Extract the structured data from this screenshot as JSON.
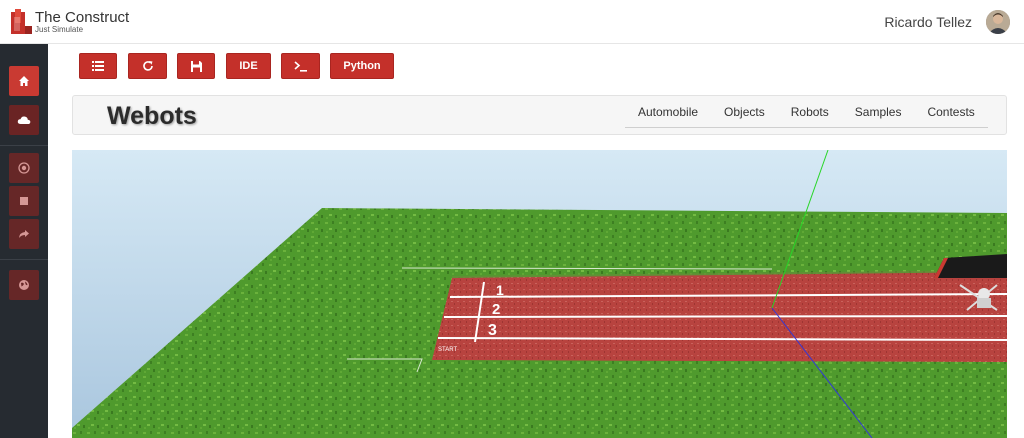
{
  "brand": {
    "name": "The Construct",
    "tagline": "Just Simulate"
  },
  "user": {
    "name": "Ricardo Tellez"
  },
  "toolbar": {
    "buttons": [
      {
        "label": "",
        "icon": "list-icon"
      },
      {
        "label": "",
        "icon": "refresh-icon"
      },
      {
        "label": "",
        "icon": "save-icon"
      },
      {
        "label": "IDE"
      },
      {
        "label": "",
        "icon": "terminal-icon"
      },
      {
        "label": "Python"
      }
    ]
  },
  "sidebar": {
    "items": [
      {
        "icon": "home-icon",
        "state": "active"
      },
      {
        "icon": "cloud-icon",
        "state": "selected"
      },
      {
        "icon": "record-icon",
        "state": "disabled"
      },
      {
        "icon": "stop-icon",
        "state": "disabled"
      },
      {
        "icon": "share-icon",
        "state": "disabled"
      },
      {
        "icon": "globe-icon",
        "state": "disabled"
      }
    ]
  },
  "webots": {
    "title": "Webots",
    "menu": [
      "Automobile",
      "Objects",
      "Robots",
      "Samples",
      "Contests"
    ]
  },
  "scene": {
    "lane_numbers": [
      "1",
      "2",
      "3"
    ],
    "start_label": "START"
  },
  "colors": {
    "accent": "#c4302a",
    "sidebar": "#262b31",
    "grass": "#4e9a2c",
    "track": "#b6423f"
  }
}
